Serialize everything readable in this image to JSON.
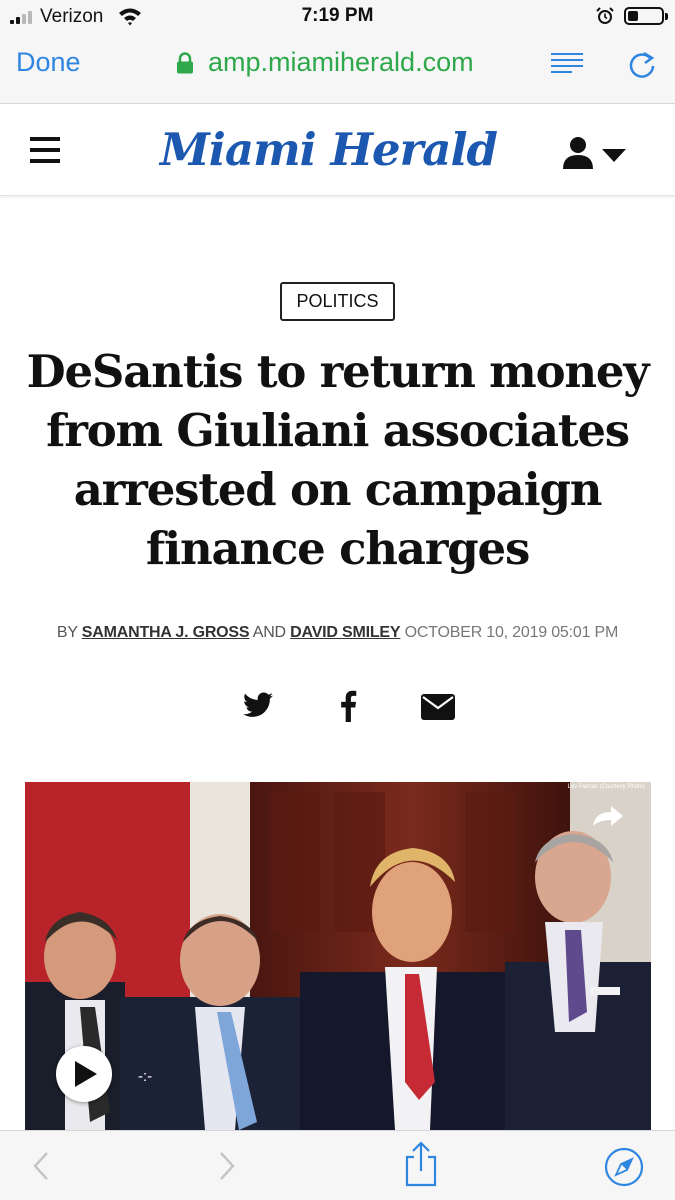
{
  "status_bar": {
    "carrier": "Verizon",
    "time": "7:19 PM",
    "battery_level": 0.3,
    "signal_bars": 2
  },
  "browser": {
    "done_label": "Done",
    "url": "amp.miamiherald.com"
  },
  "site": {
    "logo_text": "Miami Herald",
    "brand_color": "#1c58b0"
  },
  "article": {
    "category": "POLITICS",
    "headline": "DeSantis to return money from Giuliani associates arrested on campaign finance charges",
    "byline_prefix": "BY",
    "author_1": "SAMANTHA J. GROSS",
    "byline_conjunction": "AND",
    "author_2": "DAVID SMILEY",
    "date": "OCTOBER 10, 2019 05:01 PM"
  },
  "share": {
    "icons": [
      "twitter-icon",
      "facebook-icon",
      "email-icon"
    ]
  },
  "media": {
    "photo_credit": "Lev Parnas (Courtesy Photo)",
    "timecode": "-:-"
  },
  "toolbar": {
    "icons": [
      "back-icon",
      "forward-icon",
      "share-icon",
      "compass-icon"
    ]
  },
  "colors": {
    "ios_blue": "#2f86e0",
    "secure_green": "#2ea84a"
  }
}
